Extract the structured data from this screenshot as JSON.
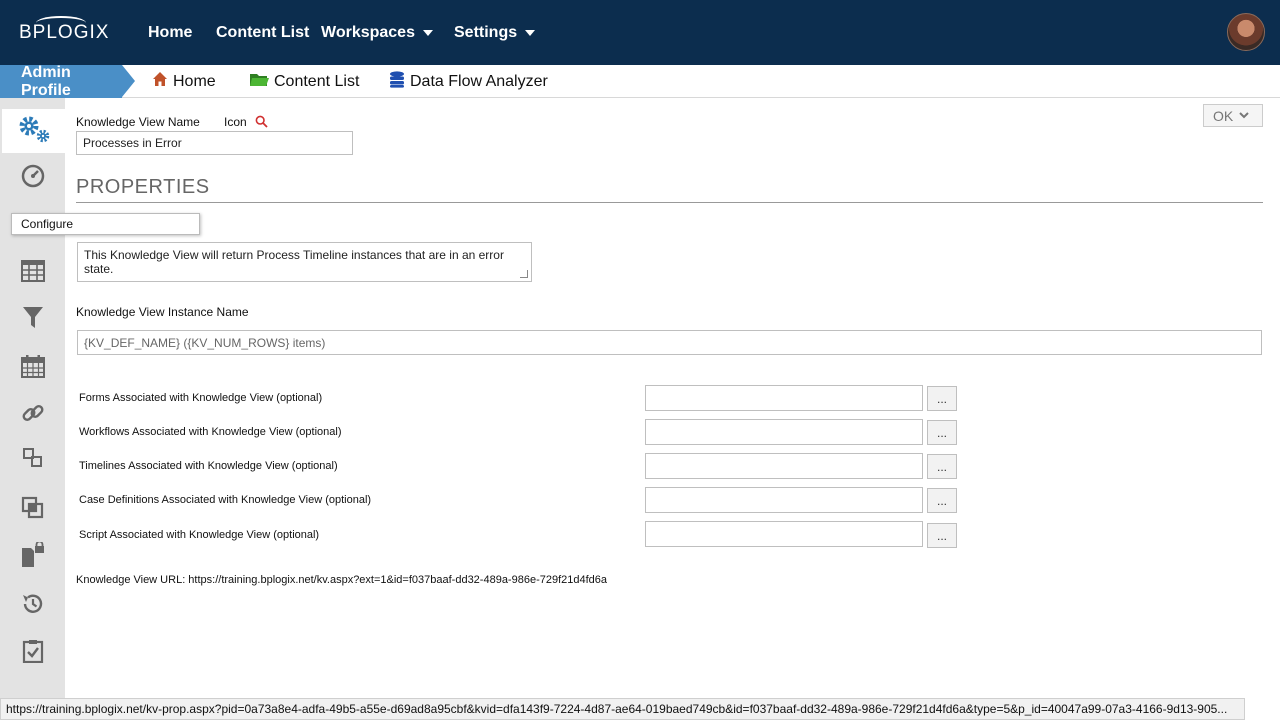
{
  "topbar": {
    "logo": "BPLOGIX",
    "nav": [
      {
        "label": "Home"
      },
      {
        "label": "Content List"
      },
      {
        "label": "Workspaces"
      },
      {
        "label": "Settings"
      }
    ],
    "avatar_icon": "user-avatar"
  },
  "breadcrumbs": {
    "active": "Admin Profile",
    "items": [
      {
        "label": "Home",
        "icon": "home-icon"
      },
      {
        "label": "Content List",
        "icon": "folder-icon"
      },
      {
        "label": "Data Flow Analyzer",
        "icon": "database-icon"
      }
    ]
  },
  "sidebar": {
    "items": [
      {
        "icon": "gears-icon",
        "active": true
      },
      {
        "icon": "dashboard-icon"
      },
      {
        "icon": "list-icon"
      },
      {
        "icon": "table-icon"
      },
      {
        "icon": "filter-icon"
      },
      {
        "icon": "calendar-icon"
      },
      {
        "icon": "link-icon"
      },
      {
        "icon": "hierarchy-icon"
      },
      {
        "icon": "clone-icon"
      },
      {
        "icon": "file-lock-icon"
      },
      {
        "icon": "history-icon"
      },
      {
        "icon": "checklist-icon"
      }
    ],
    "tooltip": "Configure"
  },
  "form": {
    "ok_label": "OK",
    "kv_name_label": "Knowledge View Name",
    "icon_label": "Icon",
    "kv_name_value": "Processes in Error",
    "section_title": "PROPERTIES",
    "description_value": "This Knowledge View will return Process Timeline instances that are in an error state.",
    "instance_name_label": "Knowledge View Instance Name",
    "instance_name_value": "{KV_DEF_NAME} ({KV_NUM_ROWS} items)",
    "assoc": [
      {
        "label": "Forms Associated with Knowledge View (optional)",
        "value": ""
      },
      {
        "label": "Workflows Associated with Knowledge View (optional)",
        "value": ""
      },
      {
        "label": "Timelines Associated with Knowledge View (optional)",
        "value": ""
      },
      {
        "label": "Case Definitions Associated with Knowledge View (optional)",
        "value": ""
      },
      {
        "label": "Script Associated with Knowledge View (optional)",
        "value": ""
      }
    ],
    "dots_label": "...",
    "url_text": "Knowledge View URL: https://training.bplogix.net/kv.aspx?ext=1&id=f037baaf-dd32-489a-986e-729f21d4fd6a"
  },
  "statusbar": {
    "text": "https://training.bplogix.net/kv-prop.aspx?pid=0a73a8e4-adfa-49b5-a55e-d69ad8a95cbf&kvid=dfa143f9-7224-4d87-ae64-019baed749cb&id=f037baaf-dd32-489a-986e-729f21d4fd6a&type=5&p_id=40047a99-07a3-4166-9d13-905..."
  },
  "colors": {
    "topbar": "#0c2d4e",
    "crumb_active": "#4a8fc7",
    "rail": "#e3e3e3",
    "home_icon": "#c0522a",
    "folder_icon": "#3a9a2a",
    "db_icon": "#1f4fb0",
    "search_icon": "#d03030"
  }
}
